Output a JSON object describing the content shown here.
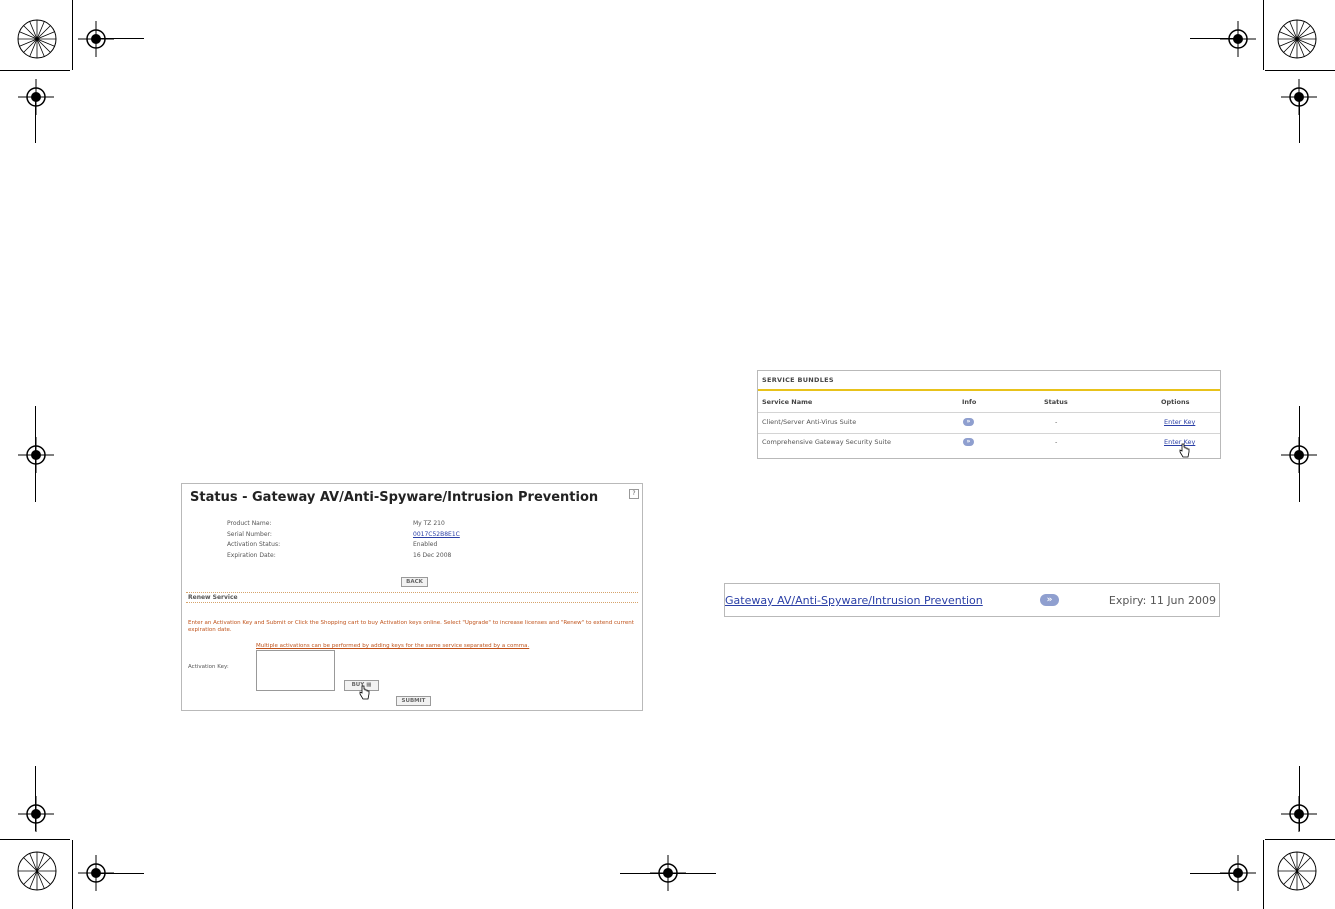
{
  "status_panel": {
    "title": "Status - Gateway AV/Anti-Spyware/Intrusion Prevention",
    "help": "?",
    "fields": [
      {
        "label": "Product Name:",
        "value": "My TZ 210"
      },
      {
        "label": "Serial Number:",
        "value": "0017C52B8E1C"
      },
      {
        "label": "Activation Status:",
        "value": "Enabled"
      },
      {
        "label": "Expiration Date:",
        "value": "16 Dec 2008"
      }
    ],
    "back_label": "BACK",
    "renew_header": "Renew Service",
    "renew_text": "Enter an Activation Key and Submit or Click the Shopping cart to buy Activation keys online. Select \"Upgrade\" to increase licenses and \"Renew\" to extend current expiration date.",
    "multi_text": "Multiple activations can be performed by adding keys for the same service separated by a comma.",
    "activation_label": "Activation Key:",
    "buy_label": "BUY",
    "submit_label": "SUBMIT"
  },
  "service_bundles": {
    "title": "SERVICE BUNDLES",
    "headers": {
      "name": "Service Name",
      "info": "Info",
      "status": "Status",
      "options": "Options"
    },
    "rows": [
      {
        "name": "Client/Server Anti-Virus Suite",
        "info": "»",
        "status": "-",
        "option": "Enter Key"
      },
      {
        "name": "Comprehensive Gateway Security Suite",
        "info": "»",
        "status": "-",
        "option": "Enter Key"
      }
    ]
  },
  "gateway_row": {
    "name": "Gateway AV/Anti-Spyware/Intrusion Prevention",
    "info": "»",
    "expiry": "Expiry: 11 Jun 2009"
  },
  "colors": {
    "accent_bar": "#e8c21a",
    "link": "#2a3fa6",
    "warning_text": "#c0531b",
    "info_chip": "#8f9fcf"
  }
}
